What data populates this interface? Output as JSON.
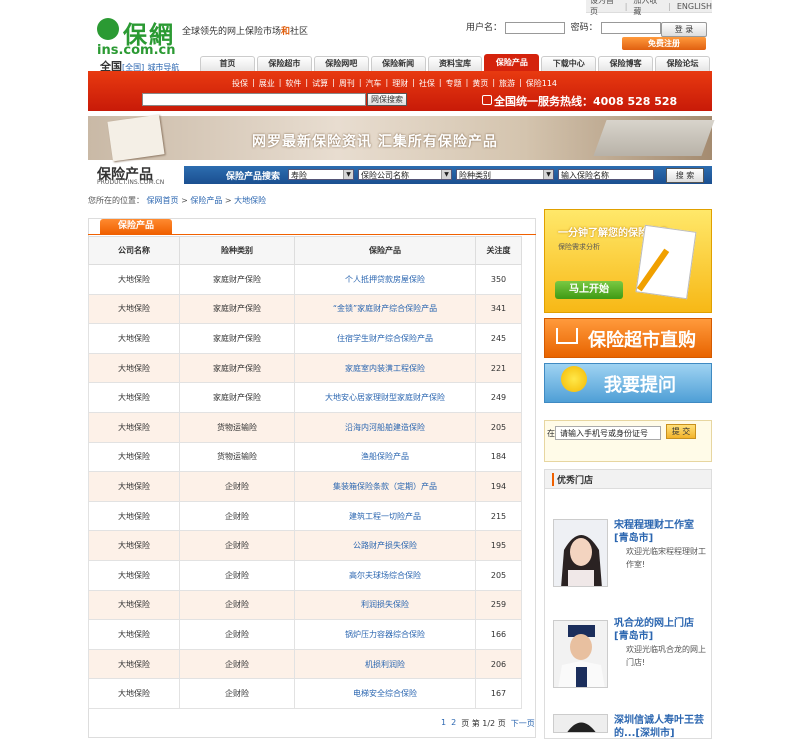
{
  "top_links": [
    "设为首页",
    "加入收藏",
    "ENGLISH"
  ],
  "logo": {
    "cn": "保網",
    "en": "ins.com.cn"
  },
  "slogan": {
    "pre": "全球领先的网上保险市场",
    "mid": "和",
    "post": "社区"
  },
  "login": {
    "username_label": "用户名：",
    "password_label": "密码：",
    "login_button": "登 录",
    "register_button": "免费注册"
  },
  "city": {
    "name": "全国",
    "bracket": "[全国]",
    "nav": "城市导航"
  },
  "nav_tabs": [
    "首页",
    "保险超市",
    "保险网吧",
    "保险新闻",
    "资料宝库",
    "保险产品",
    "下载中心",
    "保险博客",
    "保险论坛"
  ],
  "nav_active": "保险产品",
  "sub_links": [
    "投保",
    "|",
    "展业",
    "|",
    "软件",
    "|",
    "试算",
    "|",
    "周刊",
    "|",
    "汽车",
    "|",
    "理财",
    "|",
    "社保",
    "|",
    "专题",
    "|",
    "黄页",
    "|",
    "旅游",
    "|",
    "保险114"
  ],
  "search": {
    "button": "网保搜索"
  },
  "hotline": "全国统一服务热线：4008 528 528",
  "banner_text": "网罗最新保险资讯 汇集所有保险产品",
  "product_search": {
    "title": "保险产品",
    "subtitle": "PRODUCT.INS.COM.CN",
    "label": "保险产品搜索",
    "select1": "寿险",
    "select2": "保险公司名称",
    "select3": "险种类别",
    "input_value": "输入保险名称",
    "button": "搜 索"
  },
  "breadcrumb": {
    "prefix": "您所在的位置：",
    "items": [
      "保网首页",
      "保险产品",
      "大地保险"
    ],
    "sep": ">"
  },
  "panel_tab": "保险产品",
  "table": {
    "headers": [
      "公司名称",
      "险种类别",
      "保险产品",
      "关注度"
    ],
    "rows": [
      [
        "大地保险",
        "家庭财产保险",
        "个人抵押贷款房屋保险",
        "350"
      ],
      [
        "大地保险",
        "家庭财产保险",
        "“金锁”家庭财产综合保险产品",
        "341"
      ],
      [
        "大地保险",
        "家庭财产保险",
        "住宿学生财产综合保险产品",
        "245"
      ],
      [
        "大地保险",
        "家庭财产保险",
        "家庭室内装潢工程保险",
        "221"
      ],
      [
        "大地保险",
        "家庭财产保险",
        "大地安心居家理财型家庭财产保险",
        "249"
      ],
      [
        "大地保险",
        "货物运输险",
        "沿海内河船舶建造保险",
        "205"
      ],
      [
        "大地保险",
        "货物运输险",
        "渔船保险产品",
        "184"
      ],
      [
        "大地保险",
        "企财险",
        "集装箱保险条款（定期）产品",
        "194"
      ],
      [
        "大地保险",
        "企财险",
        "建筑工程一切险产品",
        "215"
      ],
      [
        "大地保险",
        "企财险",
        "公路财产损失保险",
        "195"
      ],
      [
        "大地保险",
        "企财险",
        "高尔夫球场综合保险",
        "205"
      ],
      [
        "大地保险",
        "企财险",
        "利润损失保险",
        "259"
      ],
      [
        "大地保险",
        "企财险",
        "锅炉压力容器综合保险",
        "166"
      ],
      [
        "大地保险",
        "企财险",
        "机损利润险",
        "206"
      ],
      [
        "大地保险",
        "企财险",
        "电梯安全综合保险",
        "167"
      ]
    ]
  },
  "pager": {
    "p1": "1",
    "p2": "2",
    "status": "页 第 1/2 页",
    "next": "下一页"
  },
  "ad_needs": {
    "title": "一分钟了解您的保险需求",
    "subtitle": "保险需求分析",
    "button": "马上开始"
  },
  "ad_supermarket": "保险超市直购",
  "ad_ask": "我要提问",
  "question_box": {
    "label": "在",
    "input_value": "请输入手机号或身份证号",
    "button": "提 交"
  },
  "stores": {
    "title": "优秀门店",
    "items": [
      {
        "name": "宋程程理财工作室[青岛市]",
        "desc": "欢迎光临宋程程理财工作室!"
      },
      {
        "name": "巩合龙的网上门店[青岛市]",
        "desc": "欢迎光临巩合龙的网上门店!"
      },
      {
        "name": "深圳信诚人寿叶王芸的...[深圳市]",
        "desc": ""
      }
    ]
  },
  "colors": {
    "brand_green": "#2b9a33",
    "brand_red": "#d4220c",
    "orange": "#f06000",
    "link_blue": "#2b66b0",
    "nav_blue": "#1b4f90"
  }
}
